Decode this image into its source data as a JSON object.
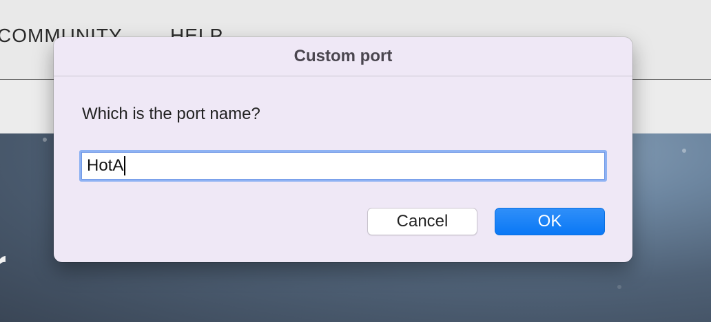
{
  "background": {
    "nav_items": [
      "COMMUNITY",
      "HELP"
    ]
  },
  "dialog": {
    "title": "Custom port",
    "message": "Which is the port name?",
    "input_value": "HotA",
    "cancel_label": "Cancel",
    "ok_label": "OK"
  },
  "colors": {
    "dialog_bg": "#efe8f6",
    "accent": "#0a78f5",
    "focus_ring": "#8eb2f3"
  }
}
